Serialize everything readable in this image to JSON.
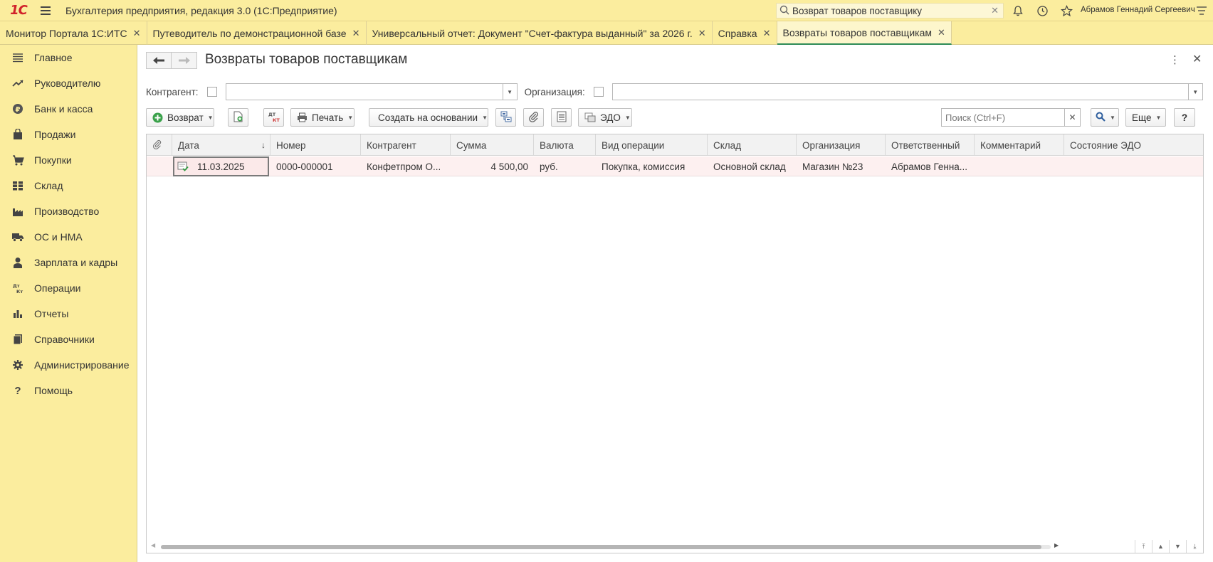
{
  "app": {
    "title": "Бухгалтерия предприятия, редакция 3.0  (1С:Предприятие)",
    "logo": "1С"
  },
  "top_search": {
    "value": "Возврат товаров поставщику"
  },
  "user": {
    "name": "Абрамов Геннадий Сергеевич"
  },
  "tabs": [
    {
      "label": "Монитор Портала 1С:ИТС"
    },
    {
      "label": "Путеводитель по демонстрационной базе"
    },
    {
      "label": "Универсальный отчет: Документ \"Счет-фактура выданный\" за 2026 г."
    },
    {
      "label": "Справка"
    },
    {
      "label": "Возвраты товаров поставщикам"
    }
  ],
  "sidebar": {
    "items": [
      {
        "label": "Главное",
        "icon": "menu-lines-icon"
      },
      {
        "label": "Руководителю",
        "icon": "trend-icon"
      },
      {
        "label": "Банк и касса",
        "icon": "coin-icon"
      },
      {
        "label": "Продажи",
        "icon": "bag-icon"
      },
      {
        "label": "Покупки",
        "icon": "cart-icon"
      },
      {
        "label": "Склад",
        "icon": "warehouse-icon"
      },
      {
        "label": "Производство",
        "icon": "factory-icon"
      },
      {
        "label": "ОС и НМА",
        "icon": "truck-icon"
      },
      {
        "label": "Зарплата и кадры",
        "icon": "person-icon"
      },
      {
        "label": "Операции",
        "icon": "dt-kt-icon"
      },
      {
        "label": "Отчеты",
        "icon": "bar-chart-icon"
      },
      {
        "label": "Справочники",
        "icon": "books-icon"
      },
      {
        "label": "Администрирование",
        "icon": "gear-icon"
      },
      {
        "label": "Помощь",
        "icon": "question-icon"
      }
    ]
  },
  "form": {
    "title": "Возвраты товаров поставщикам",
    "filters": {
      "counterparty_label": "Контрагент:",
      "organization_label": "Организация:"
    },
    "toolbar": {
      "return_label": "Возврат",
      "dtkt_label": "ДТ КТ",
      "print_label": "Печать",
      "create_based_label": "Создать на основании",
      "edo_label": "ЭДО",
      "search_placeholder": "Поиск (Ctrl+F)",
      "more_label": "Еще",
      "help_label": "?"
    },
    "columns": [
      "Дата",
      "Номер",
      "Контрагент",
      "Сумма",
      "Валюта",
      "Вид операции",
      "Склад",
      "Организация",
      "Ответственный",
      "Комментарий",
      "Состояние ЭДО"
    ],
    "rows": [
      {
        "date": "11.03.2025",
        "number": "0000-000001",
        "counterparty": "Конфетпром О...",
        "sum": "4 500,00",
        "currency": "руб.",
        "operation": "Покупка, комиссия",
        "warehouse": "Основной склад",
        "organization": "Магазин №23",
        "responsible": "Абрамов Генна...",
        "comment": "",
        "edo_state": ""
      }
    ]
  },
  "colors": {
    "panel": "#fbed9e",
    "active_tab_underline": "#2e8b57",
    "row_bg": "#fdf0f0",
    "logo_red": "#d1232a"
  }
}
